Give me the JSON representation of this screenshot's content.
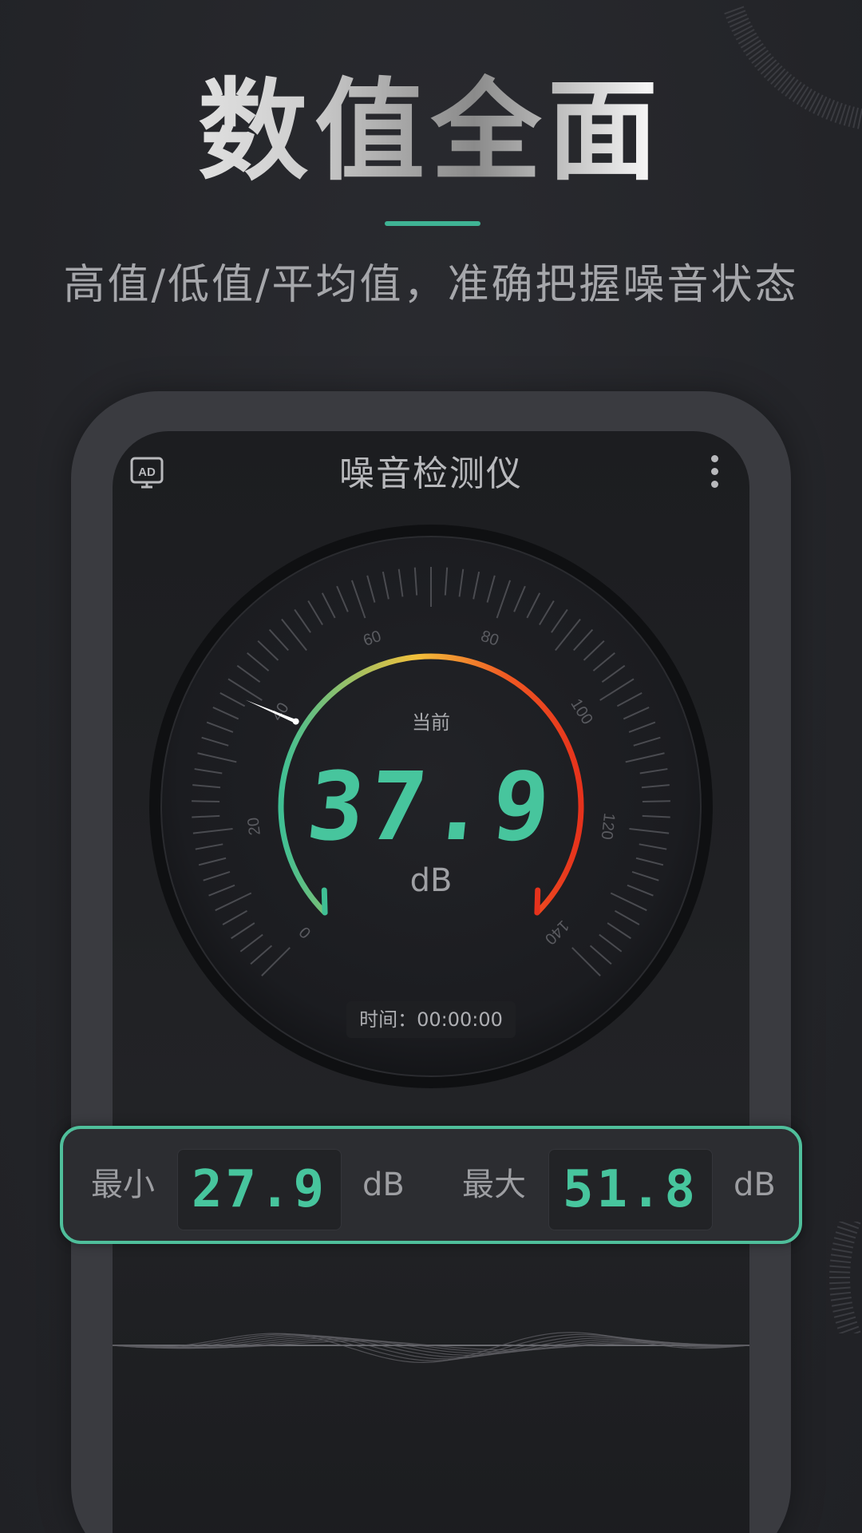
{
  "promo": {
    "headline": "数值全面",
    "subtitle": "高值/低值/平均值，准确把握噪音状态",
    "accent_color": "#3fb394"
  },
  "app": {
    "title": "噪音检测仪",
    "ad_icon": "ad-monitor-icon",
    "ad_label": "AD",
    "menu_icon": "more-vertical-icon"
  },
  "gauge": {
    "current_label": "当前",
    "current_value": "37.9",
    "unit": "dB",
    "scale_labels": [
      "0",
      "20",
      "40",
      "60",
      "80",
      "100",
      "120",
      "140"
    ],
    "scale_min": 0,
    "scale_max": 140,
    "needle_value": 40,
    "timer_label": "时间：",
    "timer_value": "00:00:00",
    "arc_colors": [
      "#3fbf94",
      "#f2c03b",
      "#f05a23",
      "#e6321c"
    ]
  },
  "stats": {
    "min_label": "最小",
    "min_value": "27.9",
    "min_unit": "dB",
    "max_label": "最大",
    "max_value": "51.8",
    "max_unit": "dB",
    "highlight_color": "#4fbf9b"
  }
}
